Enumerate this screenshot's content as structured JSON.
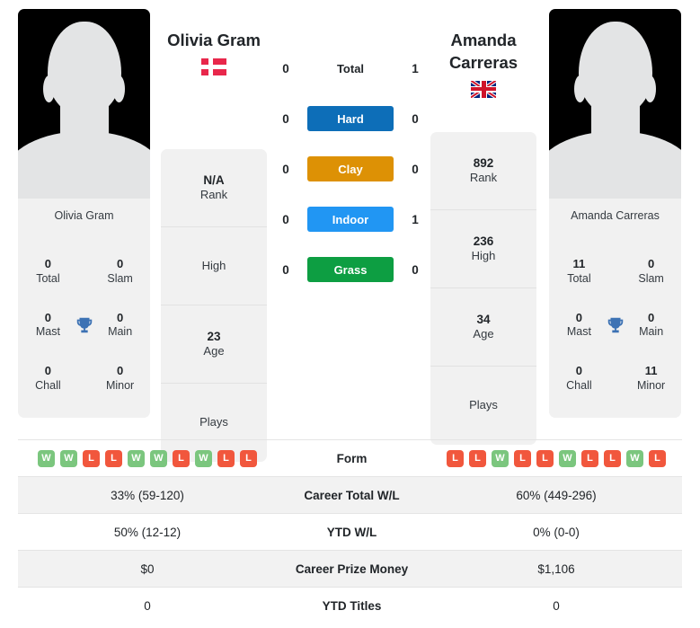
{
  "players": {
    "left": {
      "name": "Olivia Gram",
      "card_name": "Olivia Gram",
      "flag": "denmark-flag",
      "rank": "N/A",
      "rank_label": "Rank",
      "high": "",
      "high_label": "High",
      "age": "23",
      "age_label": "Age",
      "plays": "",
      "plays_label": "Plays",
      "titles": {
        "total": "0",
        "total_label": "Total",
        "slam": "0",
        "slam_label": "Slam",
        "mast": "0",
        "mast_label": "Mast",
        "main": "0",
        "main_label": "Main",
        "chall": "0",
        "chall_label": "Chall",
        "minor": "0",
        "minor_label": "Minor"
      },
      "form": [
        "W",
        "W",
        "L",
        "L",
        "W",
        "W",
        "L",
        "W",
        "L",
        "L"
      ],
      "career_total_wl": "33% (59-120)",
      "ytd_wl": "50% (12-12)",
      "career_prize_money": "$0",
      "ytd_titles": "0"
    },
    "right": {
      "name": "Amanda Carreras",
      "card_name": "Amanda Carreras",
      "flag": "united-kingdom-flag",
      "rank": "892",
      "rank_label": "Rank",
      "high": "236",
      "high_label": "High",
      "age": "34",
      "age_label": "Age",
      "plays": "",
      "plays_label": "Plays",
      "titles": {
        "total": "11",
        "total_label": "Total",
        "slam": "0",
        "slam_label": "Slam",
        "mast": "0",
        "mast_label": "Mast",
        "main": "0",
        "main_label": "Main",
        "chall": "0",
        "chall_label": "Chall",
        "minor": "11",
        "minor_label": "Minor"
      },
      "form": [
        "L",
        "L",
        "W",
        "L",
        "L",
        "W",
        "L",
        "L",
        "W",
        "L"
      ],
      "career_total_wl": "60% (449-296)",
      "ytd_wl": "0% (0-0)",
      "career_prize_money": "$1,106",
      "ytd_titles": "0"
    }
  },
  "head_to_head": [
    {
      "key": "total",
      "label": "Total",
      "left": "0",
      "right": "1",
      "style": "plain",
      "color": ""
    },
    {
      "key": "hard",
      "label": "Hard",
      "left": "0",
      "right": "0",
      "style": "badge",
      "color": "#0d6eb8"
    },
    {
      "key": "clay",
      "label": "Clay",
      "left": "0",
      "right": "0",
      "style": "badge",
      "color": "#dd9105"
    },
    {
      "key": "indoor",
      "label": "Indoor",
      "left": "0",
      "right": "1",
      "style": "badge",
      "color": "#2196f3"
    },
    {
      "key": "grass",
      "label": "Grass",
      "left": "0",
      "right": "0",
      "style": "badge",
      "color": "#0d9e42"
    }
  ],
  "comparison_rows": [
    {
      "key": "form",
      "label": "Form",
      "type": "form"
    },
    {
      "key": "career_total_wl",
      "label": "Career Total W/L",
      "type": "text"
    },
    {
      "key": "ytd_wl",
      "label": "YTD W/L",
      "type": "text"
    },
    {
      "key": "career_prize_money",
      "label": "Career Prize Money",
      "type": "text"
    },
    {
      "key": "ytd_titles",
      "label": "YTD Titles",
      "type": "text"
    }
  ],
  "colors": {
    "form_win": "#7bc67e",
    "form_loss": "#f1573d",
    "trophy": "#3d72b4",
    "card_bg": "#f1f1f1"
  },
  "icons": {
    "trophy": "trophy-icon"
  }
}
